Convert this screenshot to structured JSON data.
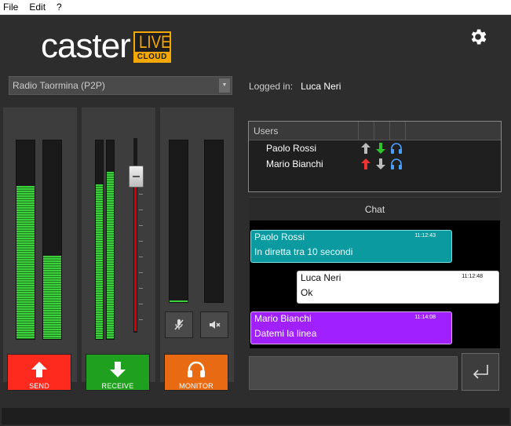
{
  "menu": {
    "file": "File",
    "edit": "Edit",
    "help": "?"
  },
  "logo": {
    "caster": "caster",
    "live": "LIVE",
    "cloud": "CLOUD"
  },
  "station": {
    "selected": "Radio Taormina (P2P)"
  },
  "login": {
    "label": "Logged in:",
    "user": "Luca Neri"
  },
  "meters": {
    "send": [
      0.77,
      0.42
    ],
    "receive": [
      0.78,
      0.84
    ],
    "monitor": [
      0.01,
      0.0
    ],
    "fader_level": 0.91
  },
  "buttons": {
    "send": "SEND",
    "receive": "RECEIVE",
    "monitor": "MONITOR"
  },
  "users": {
    "header": "Users",
    "rows": [
      {
        "name": "Paolo Rossi",
        "up": "gray",
        "down": "green"
      },
      {
        "name": "Mario Bianchi",
        "up": "red",
        "down": "gray"
      }
    ]
  },
  "chat": {
    "title": "Chat",
    "messages": [
      {
        "author": "Paolo Rossi",
        "time": "11:12:43",
        "text": "In diretta tra 10 secondi",
        "color": "#0a9aa0"
      },
      {
        "author": "Luca Neri",
        "time": "11:12:48",
        "text": "Ok",
        "color": "#ffffff"
      },
      {
        "author": "Mario Bianchi",
        "time": "11:14:08",
        "text": "Datemi la linea",
        "color": "#a020ff"
      }
    ],
    "input_value": ""
  },
  "colors": {
    "send": "#ff2a1e",
    "receive": "#1fa11f",
    "monitor": "#e86b14",
    "accent": "#f7a800"
  },
  "icons": {
    "settings": "gear-icon",
    "send": "arrow-up-icon",
    "receive": "arrow-down-icon",
    "monitor": "headphones-icon",
    "mute_mic": "mic-mute-icon",
    "mute_speaker": "speaker-mute-icon",
    "enter": "enter-icon"
  }
}
